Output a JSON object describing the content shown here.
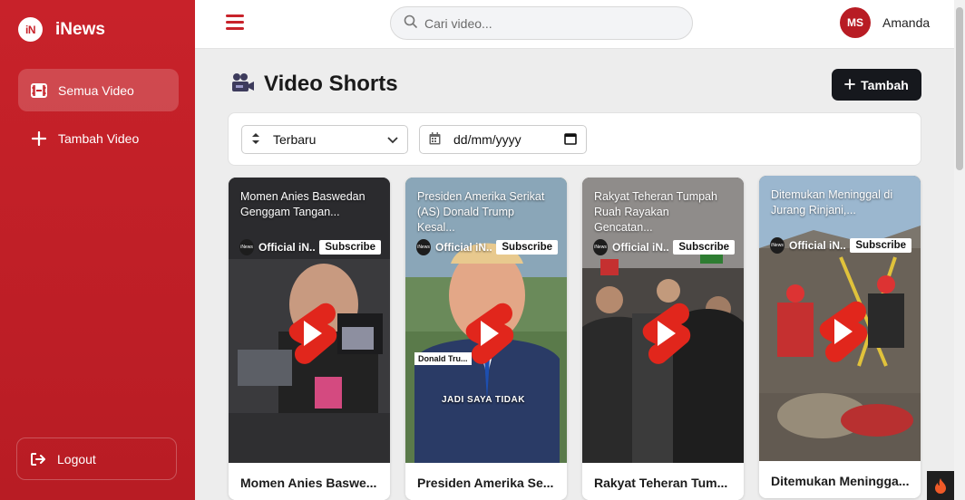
{
  "brand": {
    "logo_text": "iN",
    "name": "iNews"
  },
  "sidebar": {
    "items": [
      {
        "label": "Semua Video",
        "icon": "film-icon",
        "active": true
      },
      {
        "label": "Tambah Video",
        "icon": "plus-icon",
        "active": false
      }
    ],
    "logout_label": "Logout"
  },
  "topbar": {
    "search_placeholder": "Cari video...",
    "user_initials": "MS",
    "user_name": "Amanda"
  },
  "main": {
    "title": "Video Shorts",
    "add_button_label": "Tambah",
    "filters": {
      "sort_selected": "Terbaru",
      "date_placeholder": "dd/mm/yyyy"
    }
  },
  "videos": [
    {
      "overlay_title": "Momen Anies Baswedan Genggam Tangan...",
      "channel": "Official iN...",
      "subscribe_label": "Subscribe",
      "caption": "Momen Anies Baswe...",
      "in_video_text": ""
    },
    {
      "overlay_title": "Presiden Amerika Serikat (AS) Donald Trump Kesal...",
      "channel": "Official iN...",
      "subscribe_label": "Subscribe",
      "caption": "Presiden Amerika Se...",
      "in_video_text": "JADI SAYA TIDAK",
      "lower_third": "Donald Tru..."
    },
    {
      "overlay_title": "Rakyat Teheran Tumpah Ruah Rayakan Gencatan...",
      "channel": "Official iN...",
      "subscribe_label": "Subscribe",
      "caption": "Rakyat Teheran Tum...",
      "in_video_text": ""
    },
    {
      "overlay_title": "Ditemukan Meninggal di Jurang Rinjani,...",
      "channel": "Official iN...",
      "subscribe_label": "Subscribe",
      "caption": "Ditemukan Meningga...",
      "in_video_text": ""
    }
  ],
  "colors": {
    "brand_red": "#c8222a",
    "dark_button": "#16181d",
    "shorts_red": "#e1261c"
  }
}
